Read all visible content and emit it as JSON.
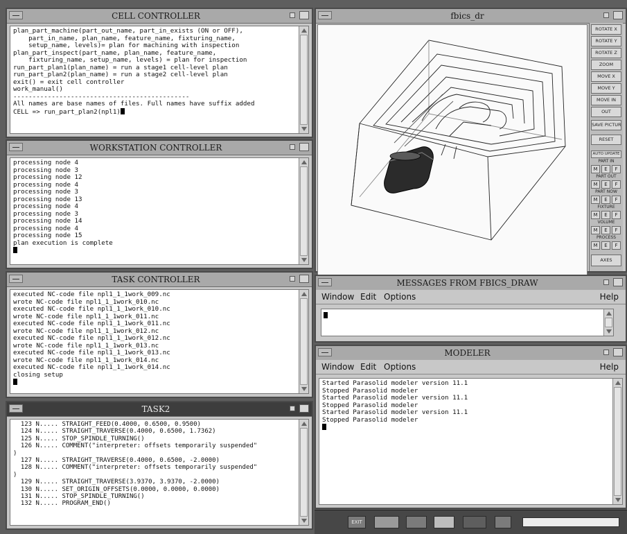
{
  "cell": {
    "title": "CELL CONTROLLER",
    "lines": [
      "plan_part_machine(part_out_name, part_in_exists (ON or OFF),",
      "    part_in_name, plan_name, feature_name, fixturing_name,",
      "    setup_name, levels)= plan for machining with inspection",
      "plan_part_inspect(part_name, plan_name, feature_name,",
      "    fixturing_name, setup_name, levels) = plan for inspection",
      "run_part_plan1(plan_name) = run a stage1 cell-level plan",
      "run_part_plan2(plan_name) = run a stage2 cell-level plan",
      "exit() = exit cell controller",
      "work_manual()",
      "----------------------------------------------",
      "",
      "All names are base names of files. Full names have suffix added"
    ],
    "prompt": "CELL => run_part_plan2(npl1)"
  },
  "workstation": {
    "title": "WORKSTATION CONTROLLER",
    "lines": [
      "processing node 4",
      "processing node 3",
      "processing node 12",
      "processing node 4",
      "processing node 3",
      "processing node 13",
      "processing node 4",
      "processing node 3",
      "processing node 14",
      "processing node 4",
      "processing node 15",
      "plan execution is complete"
    ]
  },
  "task": {
    "title": "TASK CONTROLLER",
    "lines": [
      "executed NC-code file npl1_1_1work_009.nc",
      "wrote NC-code file npl1_1_1work_010.nc",
      "executed NC-code file npl1_1_1work_010.nc",
      "wrote NC-code file npl1_1_1work_011.nc",
      "executed NC-code file npl1_1_1work_011.nc",
      "wrote NC-code file npl1_1_1work_012.nc",
      "executed NC-code file npl1_1_1work_012.nc",
      "wrote NC-code file npl1_1_1work_013.nc",
      "executed NC-code file npl1_1_1work_013.nc",
      "wrote NC-code file npl1_1_1work_014.nc",
      "executed NC-code file npl1_1_1work_014.nc",
      "closing setup"
    ]
  },
  "task2": {
    "title": "TASK2",
    "lines": [
      "  123 N..... STRAIGHT_FEED(0.4000, 0.6500, 0.9500)",
      "  124 N..... STRAIGHT_TRAVERSE(0.4000, 0.6500, 1.7362)",
      "  125 N..... STOP_SPINDLE_TURNING()",
      "  126 N..... COMMENT(\"interpreter: offsets temporarily suspended\"",
      ")",
      "  127 N..... STRAIGHT_TRAVERSE(0.4000, 0.6500, -2.0000)",
      "  128 N..... COMMENT(\"interpreter: offsets temporarily suspended\"",
      ")",
      "  129 N..... STRAIGHT_TRAVERSE(3.9370, 3.9370, -2.0000)",
      "  130 N..... SET_ORIGIN_OFFSETS(0.0000, 0.0000, 0.0000)",
      "  131 N..... STOP_SPINDLE_TURNING()",
      "  132 N..... PROGRAM_END()"
    ]
  },
  "fbics": {
    "title": "fbics_dr",
    "buttons": {
      "rotate_x": "ROTATE X",
      "rotate_y": "ROTATE Y",
      "rotate_z": "ROTATE Z",
      "zoom": "ZOOM",
      "move_x": "MOVE X",
      "move_y": "MOVE Y",
      "move_in": "MOVE IN",
      "out": "OUT",
      "save_picture": "SAVE PICTURE",
      "reset": "RESET",
      "auto_update": "AUTO UPDATE",
      "axes": "AXES"
    },
    "sections": [
      "PART IN",
      "PART OUT",
      "PART NOW",
      "FIXTURE",
      "VOLUME",
      "PROCESS"
    ],
    "mef": [
      "M",
      "E",
      "F"
    ]
  },
  "messages": {
    "title": "MESSAGES FROM FBICS_DRAW",
    "menu": {
      "window": "Window",
      "edit": "Edit",
      "options": "Options",
      "help": "Help"
    }
  },
  "modeler": {
    "title": "MODELER",
    "menu": {
      "window": "Window",
      "edit": "Edit",
      "options": "Options",
      "help": "Help"
    },
    "lines": [
      "Started Parasolid modeler version 11.1",
      "Stopped Parasolid modeler",
      "Started Parasolid modeler version 11.1",
      "Stopped Parasolid modeler",
      "Started Parasolid modeler version 11.1",
      "Stopped Parasolid modeler"
    ]
  },
  "taskbar": {
    "exit": "EXIT"
  }
}
